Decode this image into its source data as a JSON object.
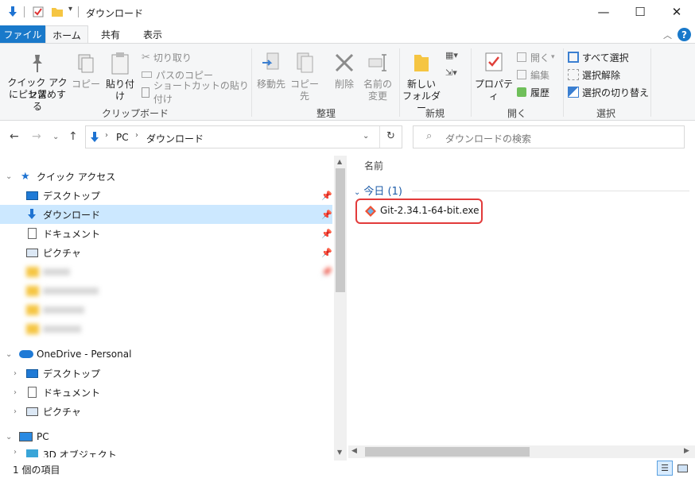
{
  "window": {
    "title": "ダウンロード",
    "minimize": "—",
    "maximize": "☐",
    "close": "✕"
  },
  "tabs": {
    "file": "ファイル",
    "home": "ホーム",
    "share": "共有",
    "view": "表示"
  },
  "ribbon": {
    "clipboard": {
      "pin_quick_access": [
        "クイック アクセス",
        "にピン留めする"
      ],
      "copy": "コピー",
      "paste": "貼り付け",
      "cut": "切り取り",
      "copy_path": "パスのコピー",
      "paste_shortcut": "ショートカットの貼り付け",
      "label": "クリップボード"
    },
    "organize": {
      "move_to": "移動先",
      "copy_to": "コピー先",
      "delete": "削除",
      "rename": [
        "名前の",
        "変更"
      ],
      "label": "整理"
    },
    "new": {
      "new_folder": [
        "新しい",
        "フォルダー"
      ],
      "label": "新規"
    },
    "open": {
      "properties": "プロパティ",
      "open": "開く",
      "edit": "編集",
      "history": "履歴",
      "label": "開く"
    },
    "select": {
      "select_all": "すべて選択",
      "select_none": "選択解除",
      "invert": "選択の切り替え",
      "label": "選択"
    },
    "help": "?"
  },
  "address": {
    "segments": [
      "PC",
      "ダウンロード"
    ],
    "search_placeholder": "ダウンロードの検索"
  },
  "nav": {
    "quick_access": "クイック アクセス",
    "desktop": "デスクトップ",
    "downloads": "ダウンロード",
    "documents": "ドキュメント",
    "pictures": "ピクチャ",
    "onedrive": "OneDrive - Personal",
    "od_desktop": "デスクトップ",
    "od_documents": "ドキュメント",
    "od_pictures": "ピクチャ",
    "pc": "PC",
    "objects3d": "3D オブジェクト"
  },
  "content": {
    "column_name": "名前",
    "group_today": "今日 (1)",
    "files": [
      {
        "name": "Git-2.34.1-64-bit.exe"
      }
    ]
  },
  "status": {
    "item_count": "1 個の項目"
  },
  "colors": {
    "accent": "#1979ca",
    "selection": "#cce8ff",
    "highlight_box": "#e23a3a",
    "group_header": "#1e5ca8"
  }
}
